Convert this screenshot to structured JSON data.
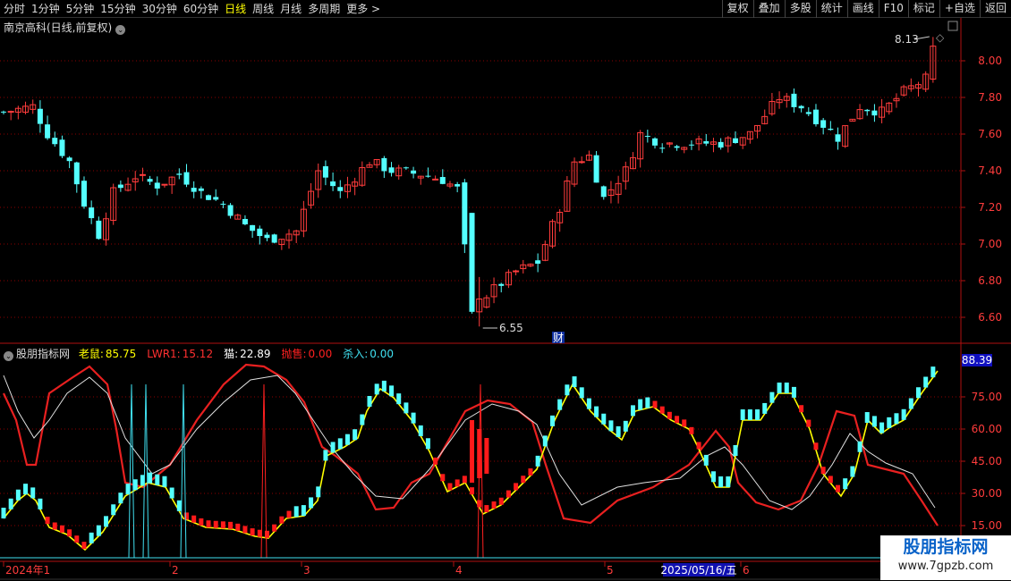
{
  "toolbar": {
    "periods": [
      "分时",
      "1分钟",
      "5分钟",
      "15分钟",
      "30分钟",
      "60分钟",
      "日线",
      "周线",
      "月线",
      "多周期",
      "更多 >"
    ],
    "active_period": "日线",
    "buttons": [
      "复权",
      "叠加",
      "多股",
      "统计",
      "画线",
      "F10",
      "标记",
      "+自选",
      "返回"
    ]
  },
  "stock": {
    "title": "南京高科(日线,前复权)"
  },
  "price_panel": {
    "y_ticks": [
      "8.00",
      "7.80",
      "7.60",
      "7.40",
      "7.20",
      "7.00",
      "6.80",
      "6.60"
    ],
    "high_label": "8.13",
    "low_label": "6.55",
    "event_marker": "财"
  },
  "indicator": {
    "name": "股朋指标网",
    "fields": [
      {
        "label": "老鼠:",
        "value": "85.75",
        "color": "#ffff00"
      },
      {
        "label": "LWR1:",
        "value": "15.12",
        "color": "#ff3030"
      },
      {
        "label": "猫:",
        "value": "22.89",
        "color": "#ffffff"
      },
      {
        "label": "抛售:",
        "value": "0.00",
        "color": "#ff2020"
      },
      {
        "label": "杀入:",
        "value": "0.00",
        "color": "#40e0f0"
      }
    ],
    "current_value": "88.39",
    "y_ticks": [
      "75.00",
      "60.00",
      "45.00",
      "30.00",
      "15.00"
    ]
  },
  "x_axis": {
    "labels": [
      "2024年1",
      "2",
      "3",
      "4",
      "5",
      "6"
    ],
    "highlight": "2025/05/16/五"
  },
  "watermark": {
    "title": "股朋指标网",
    "url": "www.7gpzb.com"
  },
  "colors": {
    "up": "#ff3c3c",
    "down": "#54ffff",
    "grid": "#8b0000",
    "axis": "#b01010"
  }
}
